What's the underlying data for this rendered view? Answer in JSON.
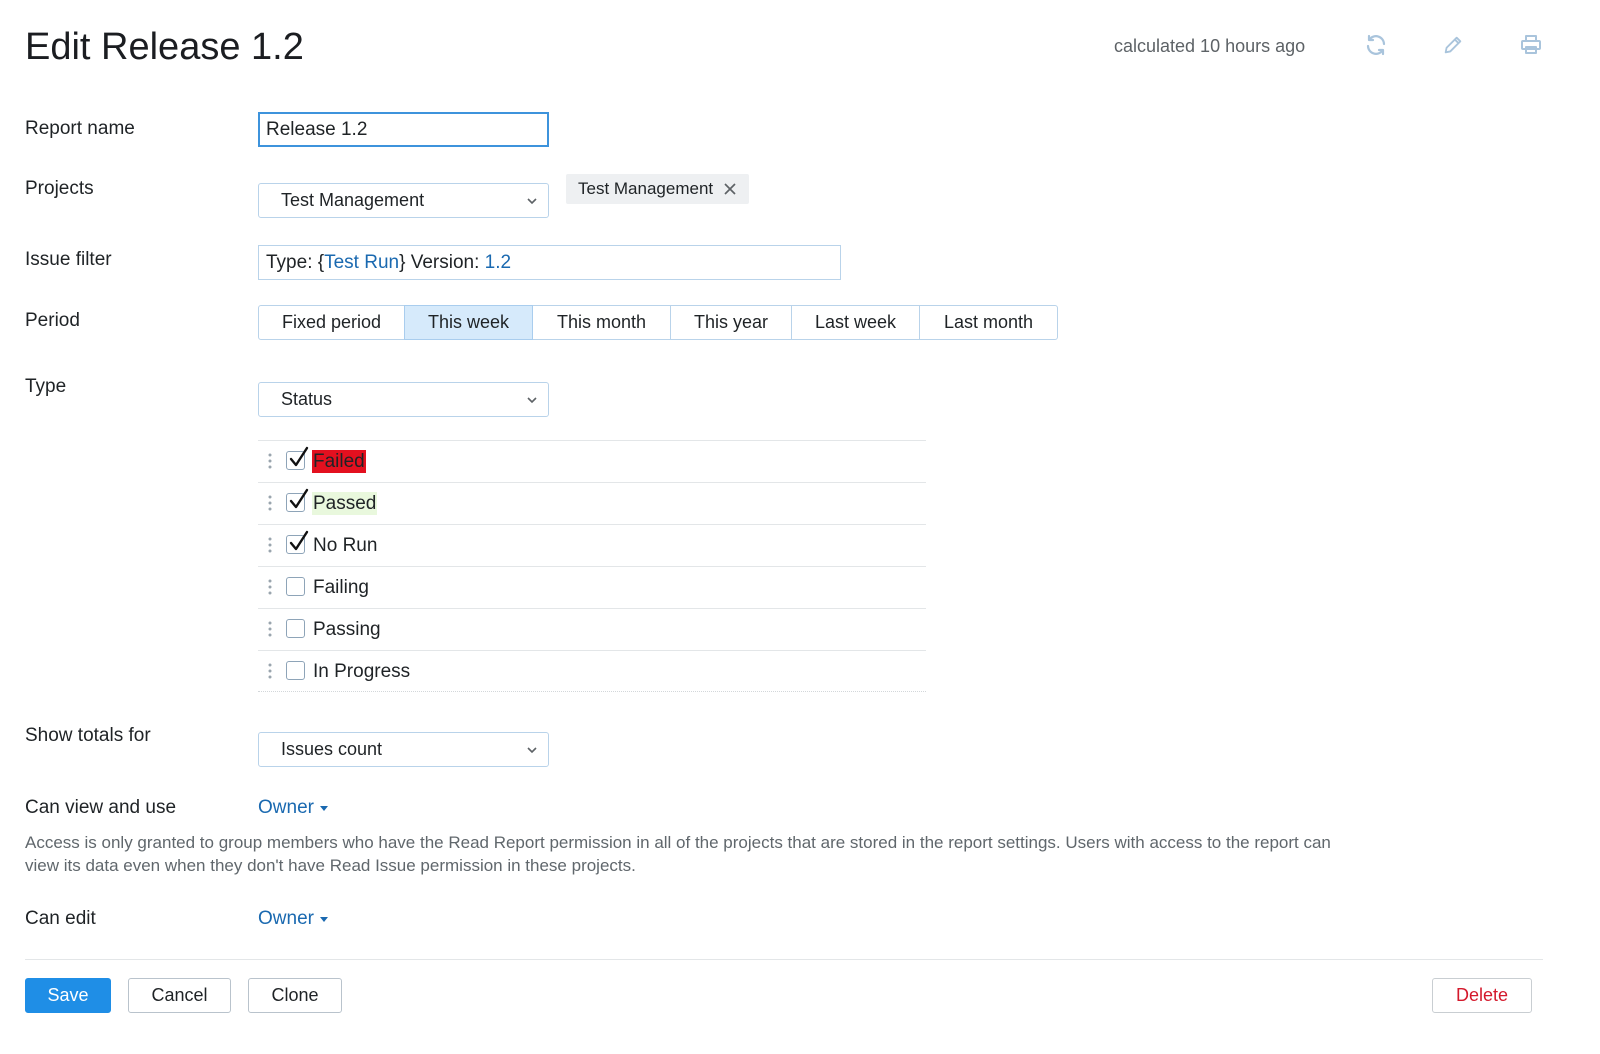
{
  "header": {
    "title": "Edit Release 1.2",
    "calculated": "calculated 10 hours ago",
    "icons": [
      "refresh-icon",
      "pencil-icon",
      "print-icon"
    ]
  },
  "form": {
    "report_name": {
      "label": "Report name",
      "value": "Release 1.2"
    },
    "projects": {
      "label": "Projects",
      "selected": "Test Management",
      "tag": "Test Management"
    },
    "issue_filter": {
      "label": "Issue filter",
      "parts": {
        "type_key": "Type: {",
        "type_value": "Test Run",
        "version_key": "} Version: ",
        "version_value": "1.2"
      }
    },
    "period": {
      "label": "Period",
      "options": [
        "Fixed period",
        "This week",
        "This month",
        "This year",
        "Last week",
        "Last month"
      ],
      "selected": "This week"
    },
    "type": {
      "label": "Type",
      "selected": "Status",
      "statuses": [
        {
          "label": "Failed",
          "checked": true,
          "highlight": "#e3101f"
        },
        {
          "label": "Passed",
          "checked": true,
          "highlight": "#e9f8dd"
        },
        {
          "label": "No Run",
          "checked": true,
          "highlight": ""
        },
        {
          "label": "Failing",
          "checked": false,
          "highlight": ""
        },
        {
          "label": "Passing",
          "checked": false,
          "highlight": ""
        },
        {
          "label": "In Progress",
          "checked": false,
          "highlight": ""
        }
      ]
    },
    "show_totals": {
      "label": "Show totals for",
      "selected": "Issues count"
    },
    "can_view": {
      "label": "Can view and use",
      "value": "Owner",
      "help": "Access is only granted to group members who have the Read Report permission in all of the projects that are stored in the report settings. Users with access to the report can view its data even when they don't have Read Issue permission in these projects."
    },
    "can_edit": {
      "label": "Can edit",
      "value": "Owner"
    }
  },
  "footer": {
    "save": "Save",
    "cancel": "Cancel",
    "clone": "Clone",
    "delete": "Delete"
  },
  "colors": {
    "accent": "#1f8ee6",
    "link": "#1a69b0",
    "danger": "#d4192c",
    "active_segment": "#d6eafb"
  }
}
